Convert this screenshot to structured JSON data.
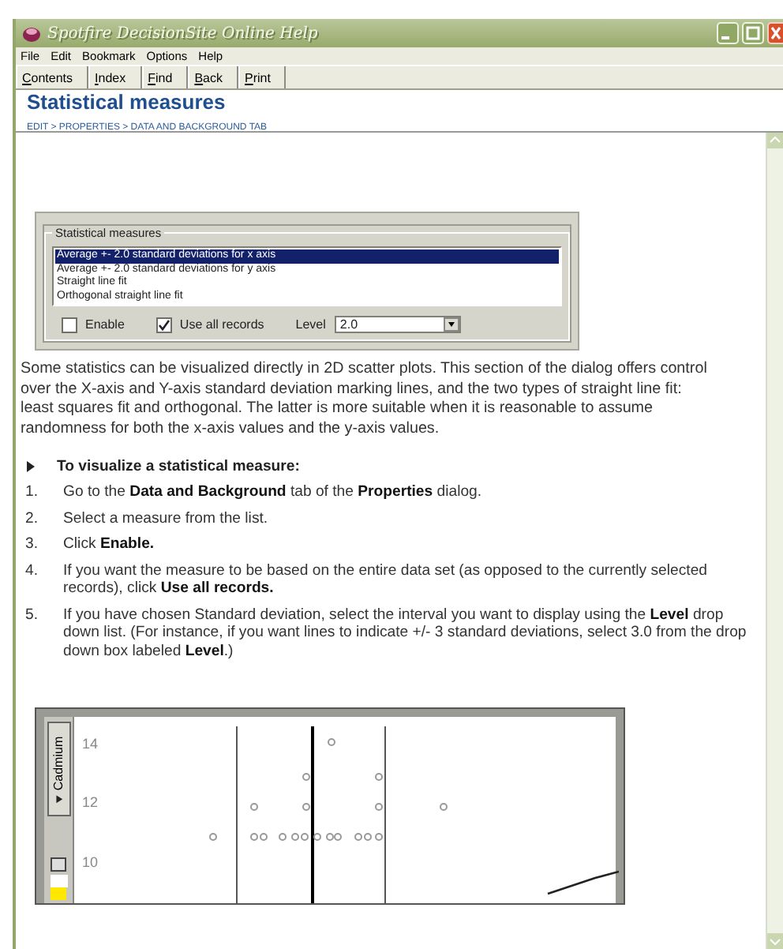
{
  "window": {
    "title": "Spotfire DecisionSite Online Help"
  },
  "menu": [
    "File",
    "Edit",
    "Bookmark",
    "Options",
    "Help"
  ],
  "toolbar": [
    "Contents",
    "Index",
    "Find",
    "Back",
    "Print"
  ],
  "page": {
    "title": "Statistical measures",
    "breadcrumb": "EDIT > PROPERTIES > DATA AND BACKGROUND TAB"
  },
  "dialog": {
    "group_title": "Statistical measures",
    "list": [
      {
        "label": "Average +- 2.0 standard deviations for x axis",
        "selected": true
      },
      {
        "label": "Average +- 2.0 standard deviations for y axis",
        "selected": false
      },
      {
        "label": "Straight line fit",
        "selected": false
      },
      {
        "label": "Orthogonal straight line fit",
        "selected": false
      }
    ],
    "checkboxes": [
      {
        "label": "Enable",
        "checked": false
      },
      {
        "label": "Use all records",
        "checked": true
      }
    ],
    "level": {
      "label": "Level",
      "value": "2.0"
    }
  },
  "intro": "Some statistics can be visualized directly in 2D scatter plots. This section of the dialog offers control over the X-axis and Y-axis standard deviation marking lines, and the two types of straight line fit: least squares fit and orthogonal. The latter is more suitable when it is reasonable to assume randomness for both the x-axis values and the y-axis values.",
  "procedure": {
    "heading": "To visualize a statistical measure:",
    "steps": [
      {
        "number": "1.",
        "text": "Go to the **Data and Background** tab of the **Properties** dialog."
      },
      {
        "number": "2.",
        "text": "Select a measure from the list."
      },
      {
        "number": "3.",
        "text": "Click **Enable.**"
      },
      {
        "number": "4.",
        "text": "If you want the measure to be based on the entire data set (as opposed to the currently selected records), click **Use all records.**"
      },
      {
        "number": "5.",
        "text": "If you have chosen Standard deviation, select the interval you want to display using the **Level** drop down list. (For instance, if you want lines to indicate +/- 3 standard deviations, select 3.0 from the drop down box labeled **Level**.)"
      }
    ]
  },
  "plot": {
    "axis_tab": "Cadmium",
    "y_tick_labels": [
      "14",
      "12",
      "10"
    ]
  }
}
